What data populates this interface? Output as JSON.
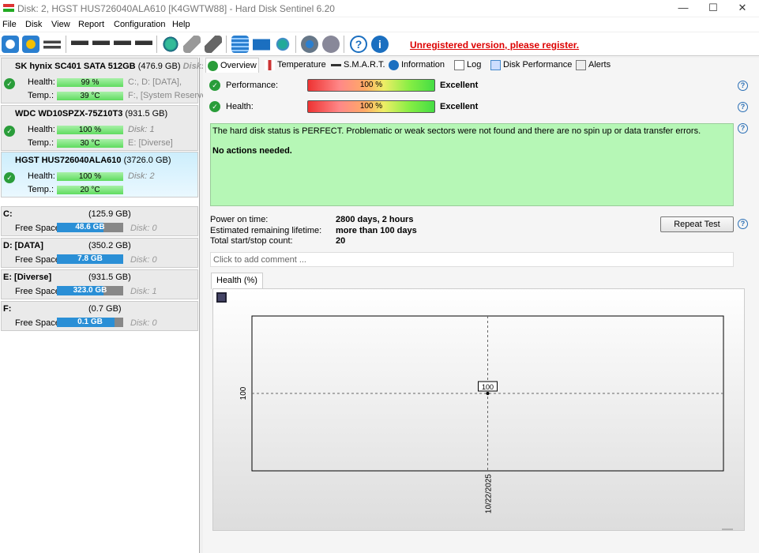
{
  "window": {
    "title": "Disk: 2, HGST HUS726040ALA610 [K4GWTW88]  -  Hard Disk Sentinel 6.20",
    "minimize": "—",
    "maximize": "☐",
    "close": "✕"
  },
  "menu": [
    "File",
    "Disk",
    "View",
    "Report",
    "Configuration",
    "Help"
  ],
  "toolbar": {
    "register_text": "Unregistered version, please register.",
    "icons": [
      "refresh-icon",
      "refresh-warning-icon",
      "disk-list-icon",
      "disk-test-icon",
      "disk-schedule-icon",
      "disk-ok-icon",
      "disk-search-icon",
      "network-disk-icon",
      "usb-disk-icon",
      "removable-disk-icon",
      "report-icon",
      "mail-icon",
      "network-icon",
      "settings-icon",
      "sound-icon",
      "help-icon",
      "info-icon"
    ]
  },
  "disks": [
    {
      "name": "SK hynix SC401 SATA 512GB",
      "size": "(476.9 GB)",
      "disk": "Disk: 0",
      "health": "99 %",
      "temp": "39 °C",
      "vol1": "C:, D: [DATA],",
      "vol2": "F:, [System Reserved]"
    },
    {
      "name": "WDC WD10SPZX-75Z10T3",
      "size": "(931.5 GB)",
      "disk": "Disk: 1",
      "health": "100 %",
      "temp": "30 °C",
      "vol1": "Disk: 1",
      "vol2": "E: [Diverse]"
    },
    {
      "name": "HGST HUS726040ALA610",
      "size": "(3726.0 GB)",
      "disk": "Disk: 2",
      "health": "100 %",
      "temp": "20 °C",
      "vol1": "Disk: 2",
      "vol2": ""
    }
  ],
  "labels": {
    "health": "Health:",
    "temp": "Temp.:",
    "free_space": "Free Space"
  },
  "volumes": [
    {
      "name": "C:",
      "size": "(125.9 GB)",
      "free": "48.6 GB",
      "disk": "Disk: 0",
      "fill_pct": 70
    },
    {
      "name": "D: [DATA]",
      "size": "(350.2 GB)",
      "free": "7.8 GB",
      "disk": "Disk: 0",
      "fill_pct": 100
    },
    {
      "name": "E: [Diverse]",
      "size": "(931.5 GB)",
      "free": "323.0 GB",
      "disk": "Disk: 1",
      "fill_pct": 70
    },
    {
      "name": "F:",
      "size": "(0.7 GB)",
      "free": "0.1 GB",
      "disk": "Disk: 0",
      "fill_pct": 87
    }
  ],
  "tabs": [
    "Overview",
    "Temperature",
    "S.M.A.R.T.",
    "Information",
    "Log",
    "Disk Performance",
    "Alerts"
  ],
  "overview": {
    "performance_label": "Performance:",
    "performance_value": "100 %",
    "performance_rating": "Excellent",
    "health_label": "Health:",
    "health_value": "100 %",
    "health_rating": "Excellent",
    "status_text": "The hard disk status is PERFECT. Problematic or weak sectors were not found and there are no spin up or data transfer errors.",
    "status_action": "No actions needed.",
    "power_on_label": "Power on time:",
    "power_on_value": "2800 days, 2 hours",
    "lifetime_label": "Estimated remaining lifetime:",
    "lifetime_value": "more than 100 days",
    "startstop_label": "Total start/stop count:",
    "startstop_value": "20",
    "repeat_test": "Repeat Test",
    "comment_placeholder": "Click to add comment ...",
    "chart_tab": "Health (%)"
  },
  "chart_data": {
    "type": "line",
    "x": [
      "10/22/2025"
    ],
    "values": [
      100
    ],
    "y_ticks": [
      "100"
    ],
    "data_labels": [
      "100"
    ],
    "grid": true
  }
}
